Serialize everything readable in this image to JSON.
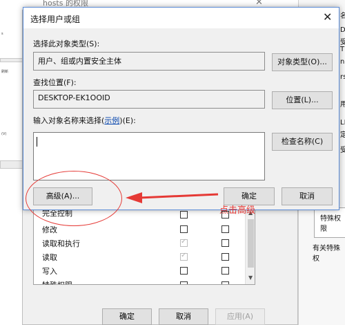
{
  "background_window": {
    "title": "hosts 的权限",
    "close_glyph": "✕",
    "permissions": [
      {
        "name": "完全控制",
        "allow_state": "unchecked",
        "deny_state": "unchecked"
      },
      {
        "name": "修改",
        "allow_state": "unchecked",
        "deny_state": "unchecked"
      },
      {
        "name": "读取和执行",
        "allow_state": "checked-disabled",
        "deny_state": "unchecked"
      },
      {
        "name": "读取",
        "allow_state": "checked-disabled",
        "deny_state": "unchecked"
      },
      {
        "name": "写入",
        "allow_state": "unchecked",
        "deny_state": "unchecked"
      },
      {
        "name": "特殊权限",
        "allow_state": "unchecked",
        "deny_state": "unchecked"
      }
    ],
    "ok_label": "确定",
    "cancel_label": "取消",
    "apply_label": "应用(A)"
  },
  "left_window": {
    "fragments": [
      "s",
      "刷新",
      "(V)"
    ]
  },
  "right_window": {
    "fragments": [
      "名",
      "D",
      "受",
      "TE",
      "ni",
      "rs",
      "用",
      "LI",
      "定",
      "受"
    ],
    "special_box_label": "特殊权限",
    "note": "有关特殊权"
  },
  "dialog": {
    "title": "选择用户或组",
    "close_glyph": "✕",
    "object_type_label": "选择此对象类型(S):",
    "object_type_value": "用户、组或内置安全主体",
    "object_types_button": "对象类型(O)...",
    "location_label": "查找位置(F):",
    "location_value": "DESKTOP-EK1OOID",
    "locations_button": "位置(L)...",
    "names_label_prefix": "输入对象名称来选择(",
    "names_label_link": "示例",
    "names_label_suffix": ")(E):",
    "names_value": "",
    "check_names_button": "检查名称(C)",
    "advanced_button": "高级(A)...",
    "ok_button": "确定",
    "cancel_button": "取消"
  },
  "annotation": {
    "text": "点击高级",
    "color": "#e53935"
  },
  "icons": {
    "close": "close-icon",
    "scroll_up": "chevron-up-icon",
    "scroll_down": "chevron-down-icon",
    "arrow": "red-arrow-icon"
  }
}
